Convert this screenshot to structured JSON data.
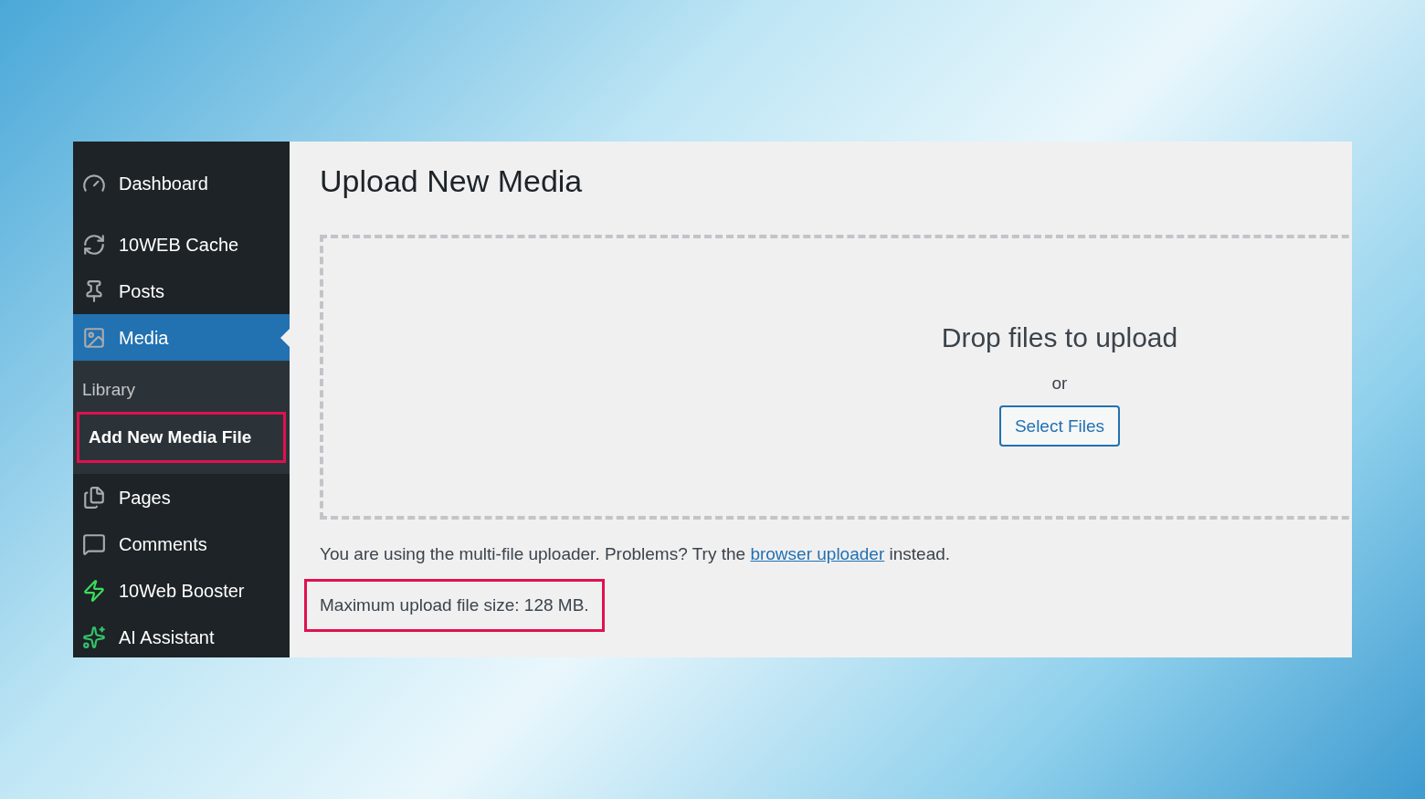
{
  "sidebar": {
    "items": [
      {
        "label": "Dashboard",
        "selected": false
      },
      {
        "label": "10WEB Cache",
        "selected": false
      },
      {
        "label": "Posts",
        "selected": false
      },
      {
        "label": "Media",
        "selected": true,
        "children": [
          {
            "label": "Library",
            "selected": false,
            "highlighted": false
          },
          {
            "label": "Add New Media File",
            "selected": true,
            "highlighted": true
          }
        ]
      },
      {
        "label": "Pages",
        "selected": false
      },
      {
        "label": "Comments",
        "selected": false
      },
      {
        "label": "10Web Booster",
        "selected": false
      },
      {
        "label": "AI Assistant",
        "selected": false
      }
    ]
  },
  "main": {
    "title": "Upload New Media",
    "dropzone": {
      "heading": "Drop files to upload",
      "or": "or",
      "button": "Select Files"
    },
    "notice": {
      "text_before": "You are using the multi-file uploader. Problems? Try the",
      "link": "browser uploader",
      "text_after": "instead."
    },
    "max_size": {
      "text": "Maximum upload file size: 128 MB.",
      "highlighted": true
    }
  }
}
